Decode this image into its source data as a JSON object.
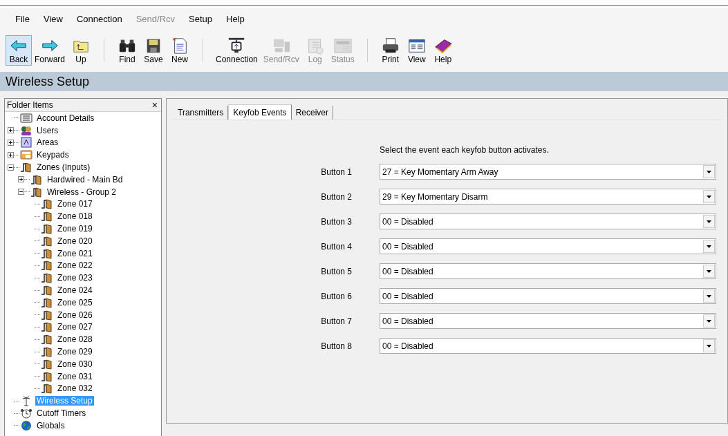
{
  "menu": [
    {
      "label": "File",
      "disabled": false
    },
    {
      "label": "View",
      "disabled": false
    },
    {
      "label": "Connection",
      "disabled": false
    },
    {
      "label": "Send/Rcv",
      "disabled": true
    },
    {
      "label": "Setup",
      "disabled": false
    },
    {
      "label": "Help",
      "disabled": false
    }
  ],
  "toolbar": [
    [
      {
        "kind": "back",
        "label": "Back",
        "disabled": false,
        "selected": true
      },
      {
        "kind": "forward",
        "label": "Forward",
        "disabled": false,
        "selected": false
      },
      {
        "kind": "up",
        "label": "Up",
        "disabled": false,
        "selected": false
      }
    ],
    [
      {
        "kind": "find",
        "label": "Find",
        "disabled": false,
        "selected": false
      },
      {
        "kind": "save",
        "label": "Save",
        "disabled": false,
        "selected": false
      },
      {
        "kind": "new",
        "label": "New",
        "disabled": false,
        "selected": false
      }
    ],
    [
      {
        "kind": "connection",
        "label": "Connection",
        "disabled": false,
        "selected": false
      },
      {
        "kind": "sendrcv",
        "label": "Send/Rcv",
        "disabled": true,
        "selected": false
      },
      {
        "kind": "log",
        "label": "Log",
        "disabled": true,
        "selected": false
      },
      {
        "kind": "status",
        "label": "Status",
        "disabled": true,
        "selected": false
      }
    ],
    [
      {
        "kind": "print",
        "label": "Print",
        "disabled": false,
        "selected": false
      },
      {
        "kind": "view",
        "label": "View",
        "disabled": false,
        "selected": false
      },
      {
        "kind": "help",
        "label": "Help",
        "disabled": false,
        "selected": false
      }
    ]
  ],
  "page_title": "Wireless Setup",
  "sidebar": {
    "title": "Folder Items",
    "close": "×",
    "items": [
      {
        "kind": "account",
        "label": "Account Details",
        "selected": false
      },
      {
        "kind": "users",
        "label": "Users",
        "selected": false,
        "expanded": false
      },
      {
        "kind": "areas",
        "label": "Areas",
        "selected": false,
        "expanded": false
      },
      {
        "kind": "keypads",
        "label": "Keypads",
        "selected": false,
        "expanded": false
      },
      {
        "kind": "door",
        "label": "Zones (Inputs)",
        "selected": false,
        "expanded": true,
        "children": [
          {
            "kind": "door",
            "label": "Hardwired - Main Bd",
            "selected": false,
            "expanded": false
          },
          {
            "kind": "door",
            "label": "Wireless - Group 2",
            "selected": false,
            "expanded": true,
            "children": [
              {
                "kind": "door",
                "label": "Zone 017",
                "selected": false
              },
              {
                "kind": "door",
                "label": "Zone 018",
                "selected": false
              },
              {
                "kind": "door",
                "label": "Zone 019",
                "selected": false
              },
              {
                "kind": "door",
                "label": "Zone 020",
                "selected": false
              },
              {
                "kind": "door",
                "label": "Zone 021",
                "selected": false
              },
              {
                "kind": "door",
                "label": "Zone 022",
                "selected": false
              },
              {
                "kind": "door",
                "label": "Zone 023",
                "selected": false
              },
              {
                "kind": "door",
                "label": "Zone 024",
                "selected": false
              },
              {
                "kind": "door",
                "label": "Zone 025",
                "selected": false
              },
              {
                "kind": "door",
                "label": "Zone 026",
                "selected": false
              },
              {
                "kind": "door",
                "label": "Zone 027",
                "selected": false
              },
              {
                "kind": "door",
                "label": "Zone 028",
                "selected": false
              },
              {
                "kind": "door",
                "label": "Zone 029",
                "selected": false
              },
              {
                "kind": "door",
                "label": "Zone 030",
                "selected": false
              },
              {
                "kind": "door",
                "label": "Zone 031",
                "selected": false
              },
              {
                "kind": "door",
                "label": "Zone 032",
                "selected": false
              }
            ]
          }
        ]
      },
      {
        "kind": "antenna",
        "label": "Wireless Setup",
        "selected": true
      },
      {
        "kind": "timers",
        "label": "Cutoff Timers",
        "selected": false
      },
      {
        "kind": "globe",
        "label": "Globals",
        "selected": false
      }
    ]
  },
  "tabs": [
    {
      "label": "Transmitters",
      "selected": false
    },
    {
      "label": "Keyfob Events",
      "selected": true
    },
    {
      "label": "Receiver",
      "selected": false
    }
  ],
  "instruction": "Select the event each keyfob button activates.",
  "buttons": [
    {
      "label": "Button 1",
      "value": "27 = Key Momentary Arm Away"
    },
    {
      "label": "Button 2",
      "value": "29 = Key Momentary Disarm"
    },
    {
      "label": "Button 3",
      "value": "00 = Disabled"
    },
    {
      "label": "Button 4",
      "value": "00 = Disabled"
    },
    {
      "label": "Button 5",
      "value": "00 = Disabled"
    },
    {
      "label": "Button 6",
      "value": "00 = Disabled"
    },
    {
      "label": "Button 7",
      "value": "00 = Disabled"
    },
    {
      "label": "Button 8",
      "value": "00 = Disabled"
    }
  ]
}
